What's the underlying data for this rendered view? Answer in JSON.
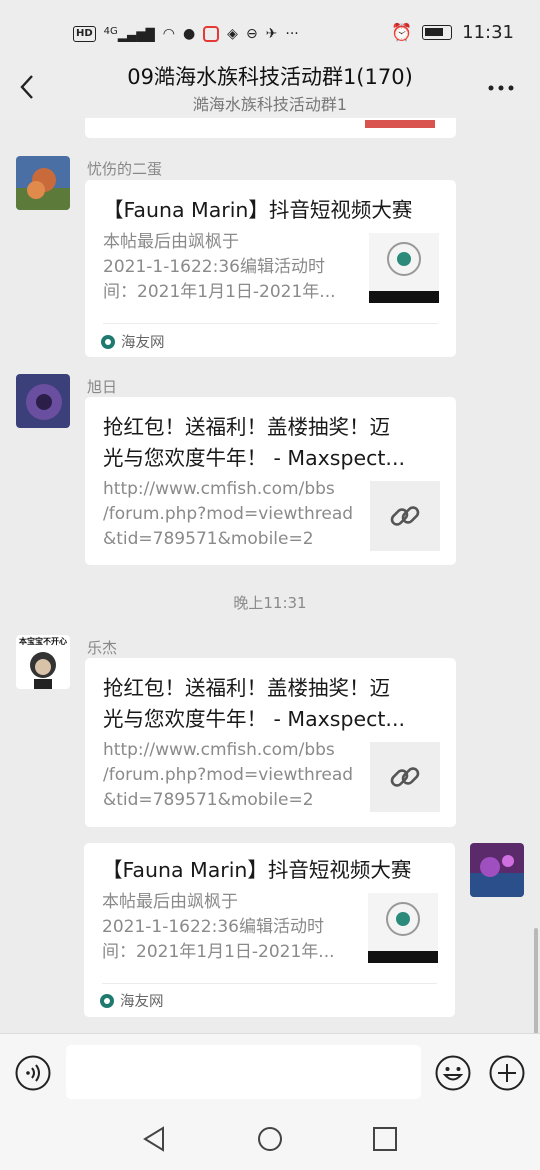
{
  "status_bar": {
    "network": "HD",
    "signal_gen": "4G",
    "time": "11:31"
  },
  "header": {
    "title": "09澔海水族科技活动群1(170)",
    "subtitle": "澔海水族科技活动群1"
  },
  "messages": [
    {
      "sender": "忧伤的二蛋",
      "card_title": "【Fauna Marin】抖音短视频大赛",
      "card_desc": [
        "本帖最后由飒枫于",
        "2021-1-1622:36编辑活动时",
        "间：2021年1月1日-2021年..."
      ],
      "source": "海友网"
    },
    {
      "sender": "旭日",
      "card_title_lines": [
        "抢红包！送福利！盖楼抽奖！迈",
        "光与您欢度牛年！ - Maxspect..."
      ],
      "card_desc": [
        "http://www.cmfish.com/bbs",
        "/forum.php?mod=viewthread",
        "&tid=789571&mobile=2"
      ]
    },
    {
      "timestamp": "晚上11:31"
    },
    {
      "sender": "乐杰",
      "avatar_caption": "本宝宝不开心",
      "card_title_lines": [
        "抢红包！送福利！盖楼抽奖！迈",
        "光与您欢度牛年！ - Maxspect..."
      ],
      "card_desc": [
        "http://www.cmfish.com/bbs",
        "/forum.php?mod=viewthread",
        "&tid=789571&mobile=2"
      ]
    },
    {
      "sender": "self",
      "card_title": "【Fauna Marin】抖音短视频大赛",
      "card_desc": [
        "本帖最后由飒枫于",
        "2021-1-1622:36编辑活动时",
        "间：2021年1月1日-2021年..."
      ],
      "source": "海友网"
    }
  ],
  "colors": {
    "bubble": "#ffffff",
    "background": "#ececec",
    "muted_text": "#8a8a8a",
    "source_icon": "#1e7a6e"
  }
}
